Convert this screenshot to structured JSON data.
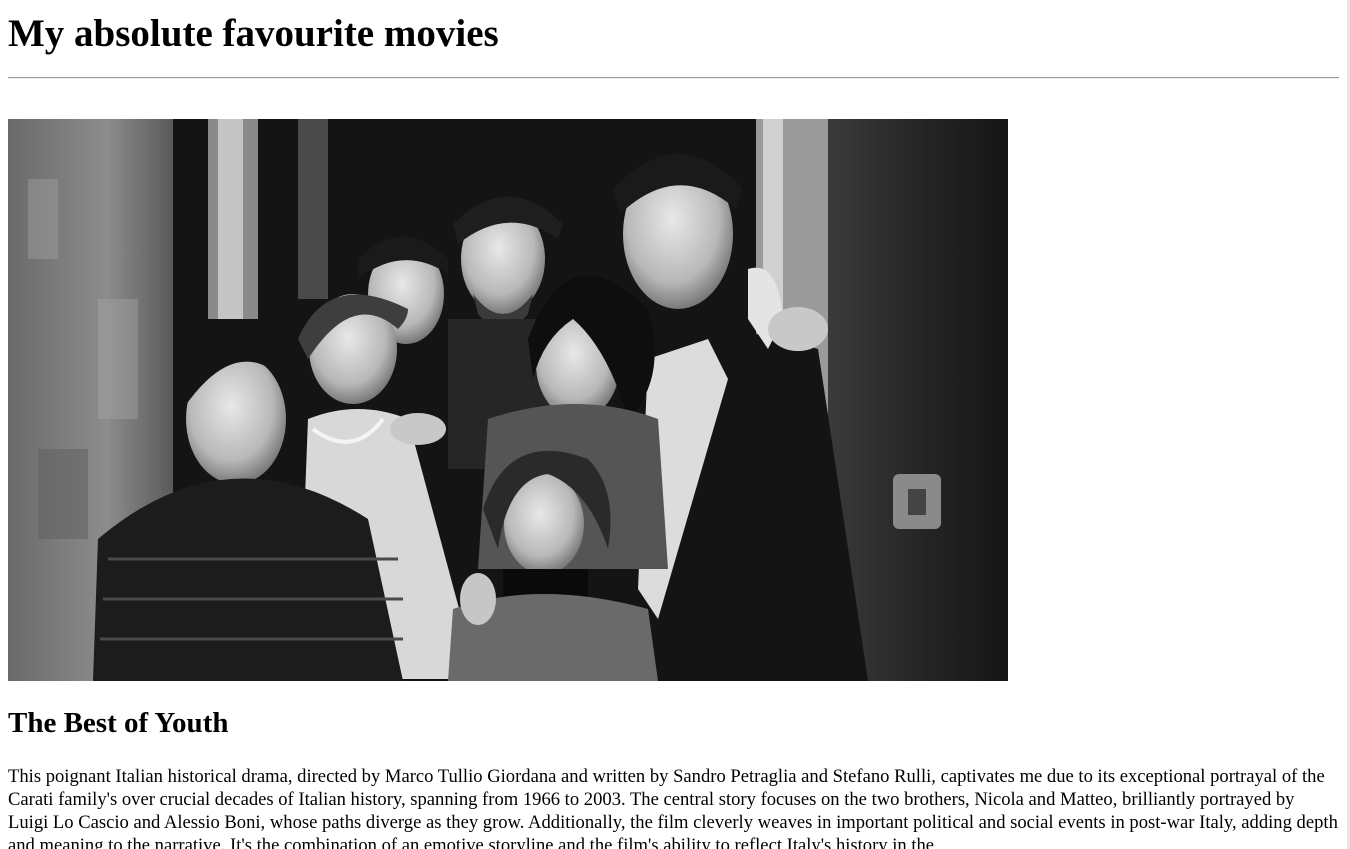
{
  "page": {
    "title": "My absolute favourite movies"
  },
  "movies": [
    {
      "title": "The Best of Youth",
      "image_alt": "Black and white photo of the Carati family smiling in a doorway",
      "description": "This poignant Italian historical drama, directed by Marco Tullio Giordana and written by Sandro Petraglia and Stefano Rulli, captivates me due to its exceptional portrayal of the Carati family's over crucial decades of Italian history, spanning from 1966 to 2003. The central story focuses on the two brothers, Nicola and Matteo, brilliantly portrayed by Luigi Lo Cascio and Alessio Boni, whose paths diverge as they grow. Additionally, the film cleverly weaves in important political and social events in post-war Italy, adding depth and meaning to the narrative. It's the combination of an emotive storyline and the film's ability to reflect Italy's history in the"
    }
  ]
}
